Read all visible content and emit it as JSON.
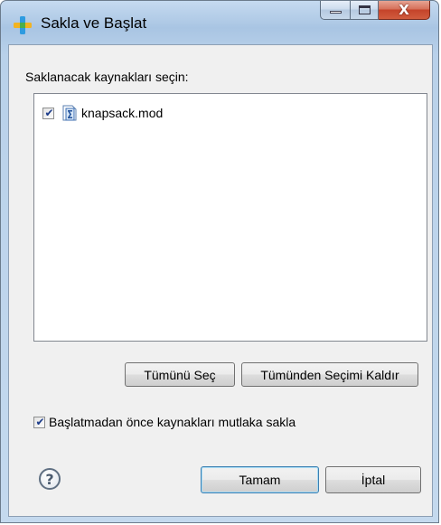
{
  "window": {
    "title": "Sakla ve Başlat",
    "controls": {
      "minimize_icon": "minimize-icon",
      "maximize_icon": "maximize-icon",
      "close_glyph": "X"
    }
  },
  "dialog": {
    "prompt": "Saklanacak kaynakları seçin:",
    "resources": [
      {
        "label": "knapsack.mod",
        "checked": true,
        "icon": "sigma-file-icon"
      }
    ],
    "select_all_label": "Tümünü Seç",
    "deselect_all_label": "Tümünden Seçimi Kaldır",
    "always_save_label": "Başlatmadan önce kaynakları mutlaka sakla",
    "always_save_checked": true,
    "help_glyph": "?",
    "ok_label": "Tamam",
    "cancel_label": "İptal"
  },
  "colors": {
    "frame": "#b9d1ea",
    "client": "#f0f0f0",
    "check_mark": "#1b3b8a",
    "default_button_border": "#3c7fb1"
  }
}
